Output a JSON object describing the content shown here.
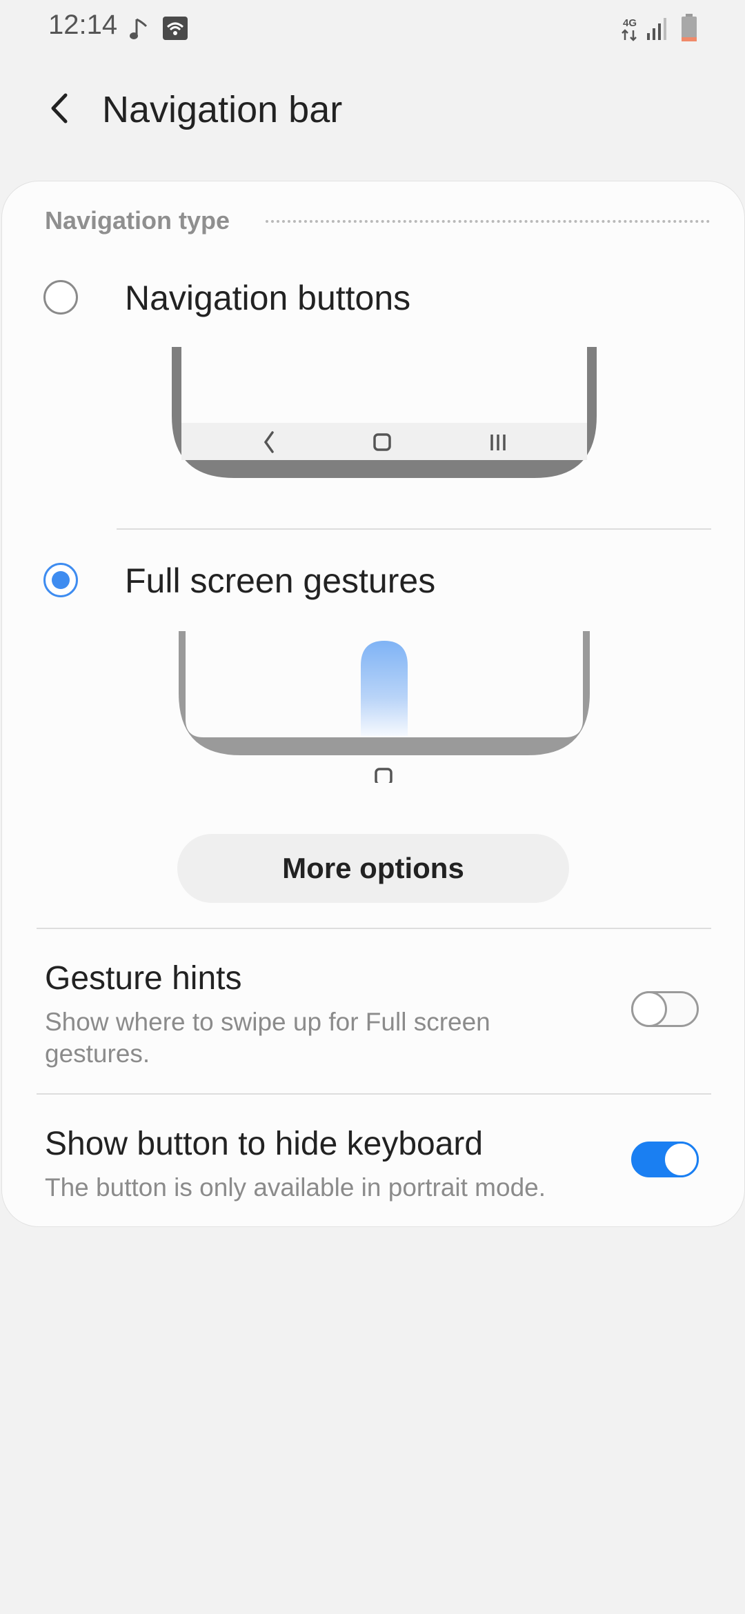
{
  "status_bar": {
    "time": "12:14",
    "network_label": "4G",
    "icons": [
      "music-note-icon",
      "wifi-icon",
      "network-4g-icon",
      "signal-icon",
      "battery-icon"
    ]
  },
  "header": {
    "title": "Navigation bar",
    "back_icon": "back-arrow-icon"
  },
  "navigation_type": {
    "section_title": "Navigation type",
    "options": [
      {
        "label": "Navigation buttons",
        "selected": false
      },
      {
        "label": "Full screen gestures",
        "selected": true
      }
    ],
    "more_options_label": "More options"
  },
  "settings": [
    {
      "title": "Gesture hints",
      "description": "Show where to swipe up for Full screen gestures.",
      "enabled": false
    },
    {
      "title": "Show button to hide keyboard",
      "description": "The button is only available in portrait mode.",
      "enabled": true
    }
  ],
  "colors": {
    "accent": "#3e8cf0",
    "toggle_on": "#1a7ff2",
    "background": "#f2f2f2",
    "card": "#fcfcfc",
    "battery_low": "#f08a6a"
  }
}
